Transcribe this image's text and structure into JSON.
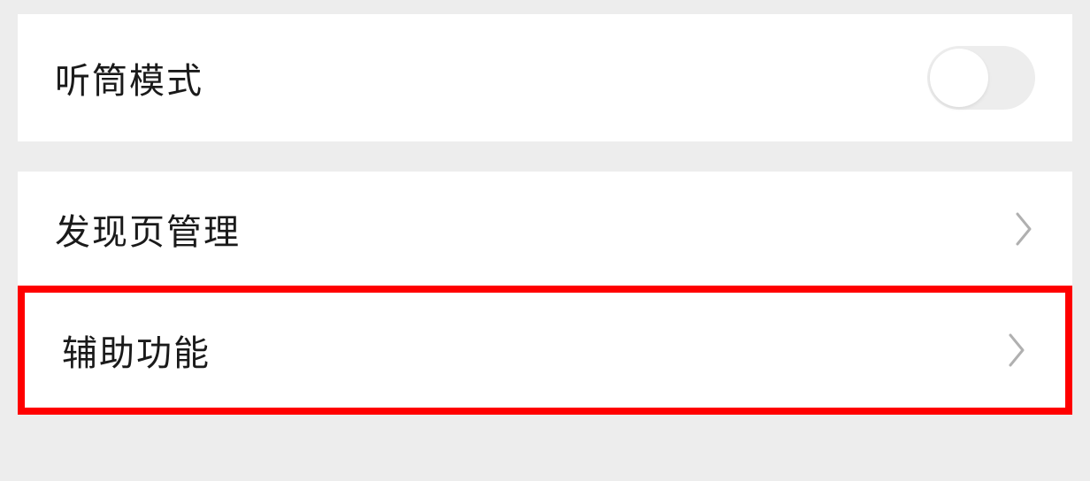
{
  "section1": {
    "earpiece_mode": {
      "label": "听筒模式",
      "enabled": false
    }
  },
  "section2": {
    "discover_page": {
      "label": "发现页管理"
    },
    "accessibility": {
      "label": "辅助功能",
      "highlighted": true
    }
  }
}
